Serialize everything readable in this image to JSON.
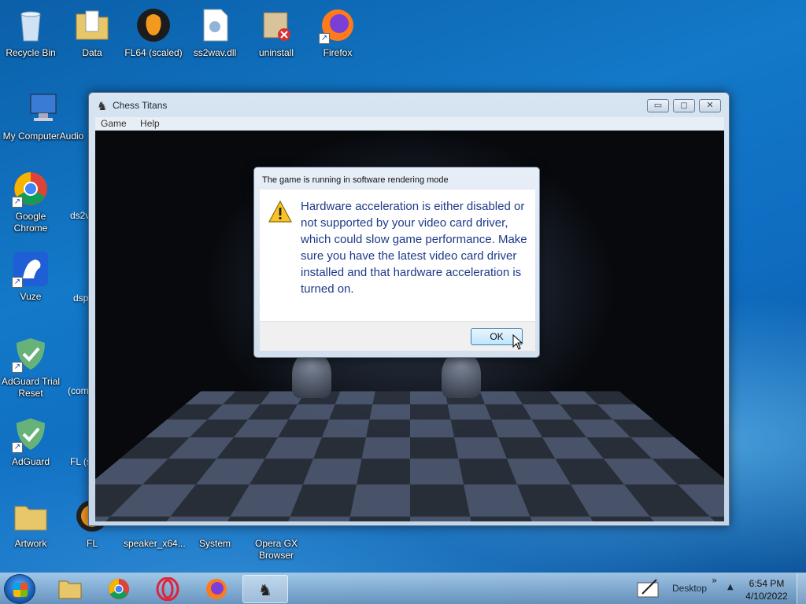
{
  "desktop": {
    "icons": [
      {
        "label": "Recycle Bin"
      },
      {
        "label": "Data"
      },
      {
        "label": "FL64 (scaled)"
      },
      {
        "label": "ss2wav.dll"
      },
      {
        "label": "uninstall"
      },
      {
        "label": "Firefox"
      },
      {
        "label": "My Computer"
      },
      {
        "label": "Google Chrome"
      },
      {
        "label": "Vuze"
      },
      {
        "label": "AdGuard Trial Reset"
      },
      {
        "label": "AdGuard"
      },
      {
        "label": "Artwork"
      },
      {
        "label": "FL"
      },
      {
        "label": "speaker_x64..."
      },
      {
        "label": "System"
      },
      {
        "label": "Opera GX Browser"
      }
    ],
    "partial_labels": [
      "Audio",
      "ds2v",
      "dsp",
      "(com",
      "FL (s"
    ]
  },
  "window": {
    "title": "Chess Titans",
    "menu": [
      "Game",
      "Help"
    ],
    "controls": {
      "minimize": "▭",
      "maximize": "◻",
      "close": "✕"
    }
  },
  "dialog": {
    "title": "The game is running in software rendering mode",
    "message": "Hardware acceleration is either disabled or not supported by your video card driver, which could slow game performance. Make sure you have the latest video card driver installed and that hardware acceleration is turned on.",
    "ok_label": "OK",
    "icon": "warning-icon"
  },
  "taskbar": {
    "items": [
      "file-explorer",
      "chrome",
      "opera",
      "firefox",
      "chess-titans"
    ],
    "desktop_label": "Desktop",
    "chevron": "»",
    "tray_arrow": "▲",
    "time": "6:54 PM",
    "date": "4/10/2022"
  }
}
